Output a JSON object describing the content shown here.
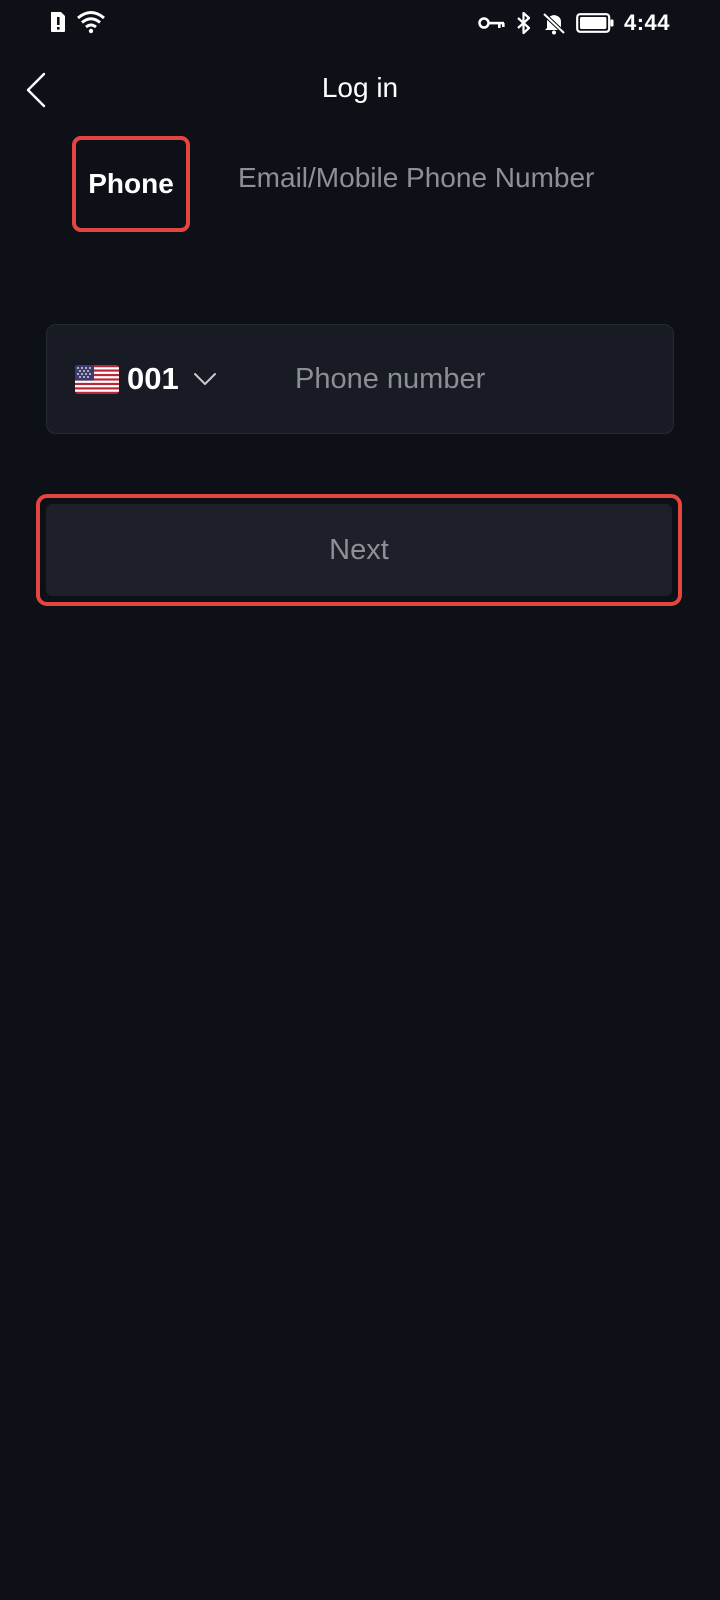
{
  "status_bar": {
    "time": "4:44",
    "icons": [
      "alert-icon",
      "wifi-icon",
      "vpn-key-icon",
      "bluetooth-icon",
      "bell-muted-icon",
      "battery-icon"
    ]
  },
  "header": {
    "title": "Log in",
    "back_icon": "chevron-left-icon"
  },
  "tabs": [
    {
      "label": "Phone",
      "selected": true
    },
    {
      "label": "Email/Mobile Phone Number",
      "selected": false
    }
  ],
  "phone_form": {
    "country_flag": "us-flag-icon",
    "country_code": "001",
    "dropdown_icon": "chevron-down-icon",
    "phone_value": "",
    "phone_placeholder": "Phone number"
  },
  "actions": {
    "next_label": "Next"
  },
  "colors": {
    "background": "#0e1018",
    "highlight": "#e5453f",
    "input_bg": "#181b23",
    "button_bg": "#1e2029",
    "muted_text": "#8e9098"
  }
}
